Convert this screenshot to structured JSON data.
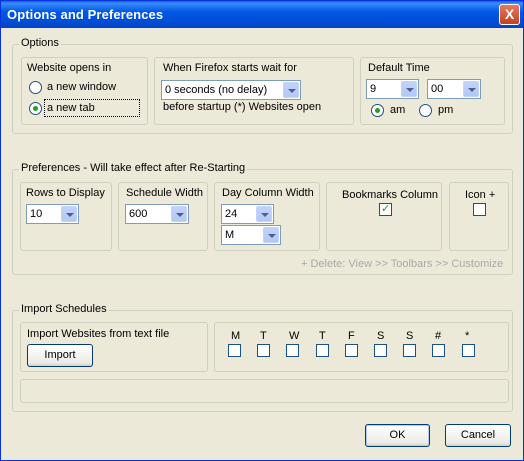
{
  "window": {
    "title": "Options and Preferences",
    "close_label": "X"
  },
  "options": {
    "legend": "Options",
    "website_opens": {
      "label": "Website opens in",
      "new_window": "a new window",
      "new_tab": "a new tab",
      "selected": "a new tab"
    },
    "firefox_wait": {
      "label": "When Firefox starts wait for",
      "value": "0 seconds (no delay)",
      "after_label": "before startup (*) Websites open"
    },
    "default_time": {
      "label": "Default Time",
      "hour": "9",
      "minute": "00",
      "am": "am",
      "pm": "pm",
      "selected": "am"
    }
  },
  "preferences": {
    "legend": "Preferences - Will take effect after Re-Starting",
    "rows_to_display": {
      "label": "Rows to Display",
      "value": "10"
    },
    "schedule_width": {
      "label": "Schedule Width",
      "value": "600"
    },
    "day_column_width": {
      "label": "Day Column Width",
      "value": "24",
      "unit": "M"
    },
    "bookmarks_column": {
      "label": "Bookmarks Column",
      "checked": true
    },
    "icon_plus": {
      "label": "Icon +",
      "checked": false
    },
    "hint": "+ Delete: View >> Toolbars >> Customize"
  },
  "import_schedules": {
    "legend": "Import Schedules",
    "import_label": "Import Websites from text file",
    "import_button": "Import",
    "days": [
      "M",
      "T",
      "W",
      "T",
      "F",
      "S",
      "S",
      "#",
      "*"
    ]
  },
  "footer": {
    "ok": "OK",
    "cancel": "Cancel"
  }
}
